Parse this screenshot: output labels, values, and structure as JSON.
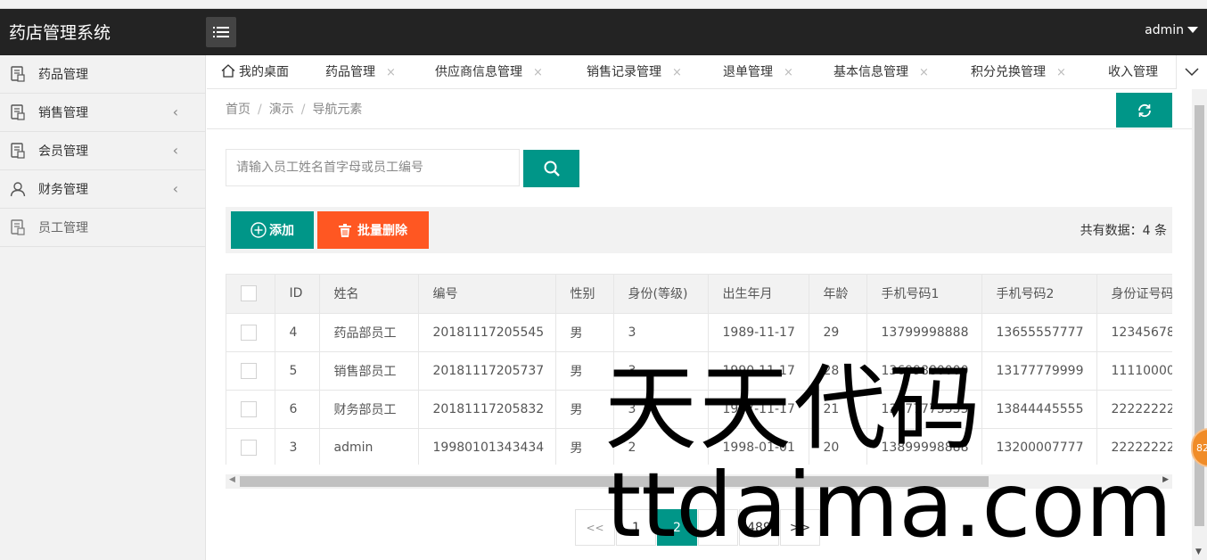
{
  "app": {
    "title": "药店管理系统",
    "user": "admin"
  },
  "sidebar": {
    "items": [
      {
        "label": "药品管理",
        "icon": "document-icon",
        "expandable": false
      },
      {
        "label": "销售管理",
        "icon": "document-icon",
        "expandable": true
      },
      {
        "label": "会员管理",
        "icon": "document-icon",
        "expandable": true
      },
      {
        "label": "财务管理",
        "icon": "user-icon",
        "expandable": true
      },
      {
        "label": "员工管理",
        "icon": "document-icon",
        "expandable": false
      }
    ]
  },
  "tabs": [
    {
      "label": "我的桌面",
      "closable": false
    },
    {
      "label": "药品管理",
      "closable": true
    },
    {
      "label": "供应商信息管理",
      "closable": true
    },
    {
      "label": "销售记录管理",
      "closable": true
    },
    {
      "label": "退单管理",
      "closable": true
    },
    {
      "label": "基本信息管理",
      "closable": true
    },
    {
      "label": "积分兑换管理",
      "closable": true
    },
    {
      "label": "收入管理",
      "closable": false
    }
  ],
  "tab_close": "×",
  "breadcrumb": {
    "items": [
      "首页",
      "演示",
      "导航元素"
    ],
    "sep": "/"
  },
  "search": {
    "placeholder": "请输入员工姓名首字母或员工编号",
    "value": ""
  },
  "toolbar": {
    "add_label": "添加",
    "delete_label": "批量删除",
    "total": "共有数据：4 条"
  },
  "table": {
    "columns": [
      "ID",
      "姓名",
      "编号",
      "性别",
      "身份(等级)",
      "出生年月",
      "年龄",
      "手机号码1",
      "手机号码2",
      "身份证号码"
    ],
    "rows": [
      [
        "4",
        "药品部员工",
        "20181117205545",
        "男",
        "3",
        "1989-11-17",
        "29",
        "13799998888",
        "13655557777",
        "12345678"
      ],
      [
        "5",
        "销售部员工",
        "20181117205737",
        "男",
        "3",
        "1990-11-17",
        "28",
        "13699880000",
        "13177779999",
        "11110000"
      ],
      [
        "6",
        "财务部员工",
        "20181117205832",
        "男",
        "3",
        "1997-11-17",
        "21",
        "13477775555",
        "13844445555",
        "22222222"
      ],
      [
        "3",
        "admin",
        "19980101343434",
        "男",
        "2",
        "1998-01-01",
        "20",
        "13899998888",
        "13200007777",
        "22222222"
      ]
    ]
  },
  "pagination": {
    "prev": "<<",
    "pages": [
      "1",
      "2",
      "3",
      "489"
    ],
    "active": "2",
    "next": ">>"
  },
  "float_badge": "82",
  "watermark": {
    "line1": "天天代码",
    "line2": "ttdaima.com"
  },
  "colors": {
    "header": "#232323",
    "primary": "#009688",
    "danger": "#ff5722",
    "sidebar": "#f2f2f2"
  }
}
